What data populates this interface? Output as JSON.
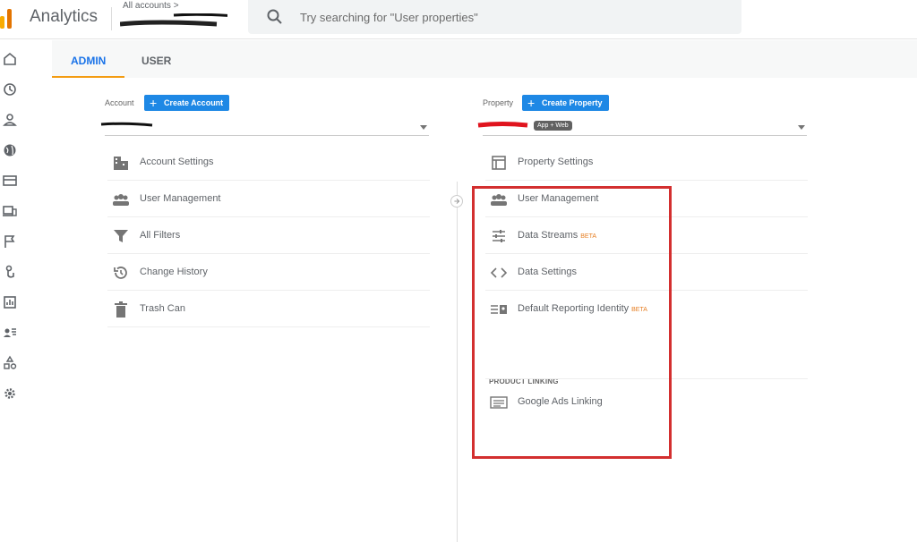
{
  "app": {
    "brand": "Analytics",
    "account_path": "All accounts >"
  },
  "search": {
    "placeholder": "Try searching for \"User properties\""
  },
  "tabs": [
    {
      "label": "ADMIN",
      "active": true
    },
    {
      "label": "USER",
      "active": false
    }
  ],
  "rail_icons": [
    "home-icon",
    "clock-icon",
    "person-icon",
    "globe-icon",
    "cards-icon",
    "devices-icon",
    "flag-icon",
    "touch-icon",
    "report-icon",
    "audience-icon",
    "shapes-icon",
    "settings-gear-icon"
  ],
  "account": {
    "label": "Account",
    "create_label": "Create Account",
    "items": [
      {
        "label": "Account Settings",
        "icon": "building-icon"
      },
      {
        "label": "User Management",
        "icon": "users-icon"
      },
      {
        "label": "All Filters",
        "icon": "filter-icon"
      },
      {
        "label": "Change History",
        "icon": "history-icon"
      },
      {
        "label": "Trash Can",
        "icon": "trash-icon"
      }
    ]
  },
  "property": {
    "label": "Property",
    "create_label": "Create Property",
    "badge": "App + Web",
    "items": [
      {
        "label": "Property Settings",
        "icon": "layout-icon"
      },
      {
        "label": "User Management",
        "icon": "users-icon"
      },
      {
        "label": "Data Streams",
        "icon": "streams-icon",
        "beta": "BETA"
      },
      {
        "label": "Data Settings",
        "icon": "code-icon"
      },
      {
        "label": "Default Reporting Identity",
        "icon": "identity-icon",
        "beta": "BETA"
      }
    ],
    "product_linking_heading": "PRODUCT LINKING",
    "linking_items": [
      {
        "label": "Google Ads Linking",
        "icon": "ads-icon"
      }
    ]
  },
  "colors": {
    "accent": "#1a73e8",
    "button": "#1e88e5",
    "tab_underline": "#f39c12",
    "highlight_box": "#d32f2f",
    "beta": "#e67e22"
  }
}
